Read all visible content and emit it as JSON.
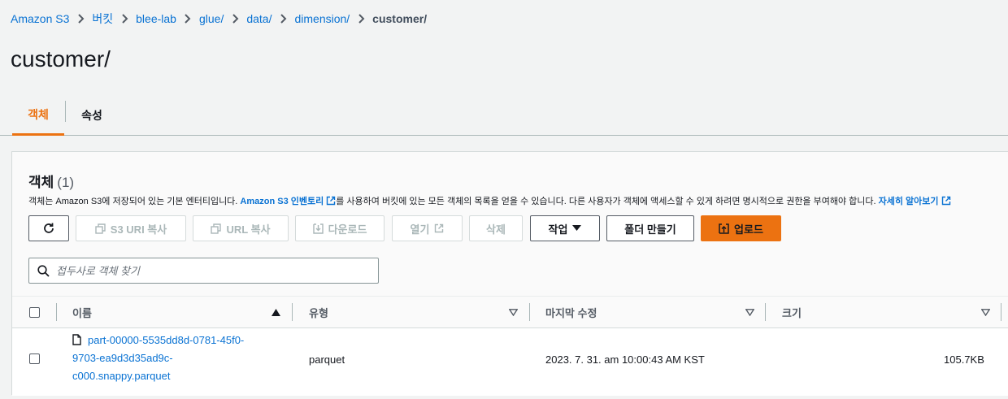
{
  "breadcrumb": {
    "items": [
      "Amazon S3",
      "버킷",
      "blee-lab",
      "glue/",
      "data/",
      "dimension/"
    ],
    "current": "customer/"
  },
  "page": {
    "title": "customer/"
  },
  "tabs": [
    {
      "label": "객체",
      "active": true
    },
    {
      "label": "속성",
      "active": false
    }
  ],
  "panel": {
    "title": "객체",
    "count": "(1)",
    "desc_before": "객체는 Amazon S3에 저장되어 있는 기본 엔터티입니다. ",
    "desc_link": "Amazon S3 인벤토리",
    "desc_middle": "를 사용하여 버킷에 있는 모든 객체의 목록을 얻을 수 있습니다. 다른 사용자가 객체에 액세스할 수 있게 하려면 명시적으로 권한을 부여해야 합니다. ",
    "learn_more": "자세히 알아보기"
  },
  "toolbar": {
    "refresh_icon": "refresh-icon",
    "copy_s3_uri": "S3 URI 복사",
    "copy_url": "URL 복사",
    "download": "다운로드",
    "open": "열기",
    "delete": "삭제",
    "actions": "작업",
    "create_folder": "폴더 만들기",
    "upload": "업로드"
  },
  "search": {
    "placeholder": "접두사로 객체 찾기"
  },
  "table": {
    "columns": [
      "이름",
      "유형",
      "마지막 수정",
      "크기"
    ],
    "rows": [
      {
        "name": "part-00000-5535dd8d-0781-45f0-9703-ea9d3d35ad9c-c000.snappy.parquet",
        "name_line1": "part-00000-5535dd8d-0781-45f0-",
        "name_line2": "9703-ea9d3d35ad9c-",
        "name_line3": "c000.snappy.parquet",
        "type": "parquet",
        "modified": "2023. 7. 31. am 10:00:43 AM KST",
        "size": "105.7KB"
      }
    ]
  },
  "colors": {
    "accent": "#ec7211",
    "link": "#0972d3",
    "text": "#16191f"
  }
}
